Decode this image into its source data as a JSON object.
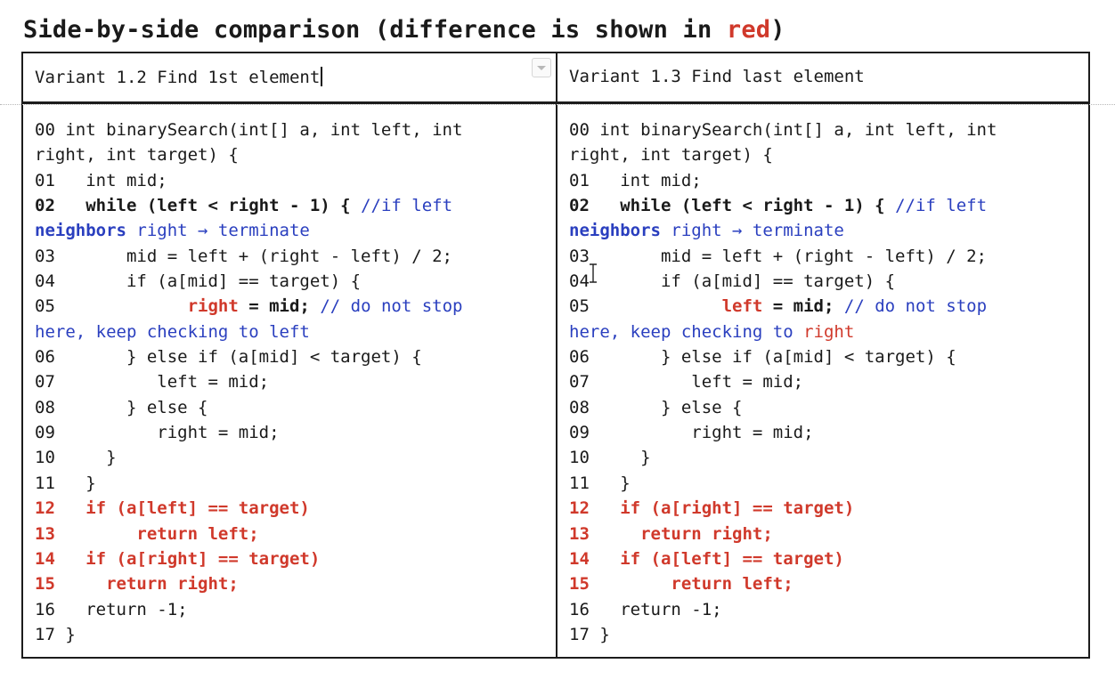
{
  "title": {
    "prefix": "Side-by-side comparison (difference is shown in ",
    "highlight": "red",
    "suffix": ")"
  },
  "left_header": "Variant 1.2 Find 1st element",
  "right_header": "Variant 1.3 Find last element",
  "left_code": {
    "l00a": "00 int binarySearch(int[] a, int left, int",
    "l00b": "right, int target) {",
    "l01": "01   int mid;",
    "l02_num": "02",
    "l02_code": "   while (left < right - 1) { ",
    "l02_comment": "//if left",
    "l02b_bold": "neighbors",
    "l02b_rest": " right → terminate",
    "l03": "03       mid = left + (right - left) / 2;",
    "l04": "04       if (a[mid] == target) {",
    "l05_pre": "05             ",
    "l05_red": "right",
    "l05_bold": " = mid;",
    "l05_comment": " // do not stop",
    "l05b": "here, keep checking to left",
    "l06": "06       } else if (a[mid] < target) {",
    "l07": "07          left = mid;",
    "l08": "08       } else {",
    "l09": "09          right = mid;",
    "l10": "10     }",
    "l11": "11   }",
    "l12": "12   if (a[left] == target)",
    "l13": "13        return left;",
    "l14": "14   if (a[right] == target)",
    "l15": "15     return right;",
    "l16": "16   return -1;",
    "l17": "17 }"
  },
  "right_code": {
    "l00a": "00 int binarySearch(int[] a, int left, int",
    "l00b": "right, int target) {",
    "l01": "01   int mid;",
    "l02_num": "02",
    "l02_code": "   while (left < right - 1) { ",
    "l02_comment": "//if left",
    "l02b_bold": "neighbors",
    "l02b_rest": " right → terminate",
    "l03": "03       mid = left + (right - left) / 2;",
    "l04": "04       if (a[mid] == target) {",
    "l05_pre": "05             ",
    "l05_red": "left",
    "l05_bold": " = mid;",
    "l05_comment": " // do not stop",
    "l05b_blue": "here, keep checking to ",
    "l05b_red": "right",
    "l06": "06       } else if (a[mid] < target) {",
    "l07": "07          left = mid;",
    "l08": "08       } else {",
    "l09": "09          right = mid;",
    "l10": "10     }",
    "l11": "11   }",
    "l12": "12   if (a[right] == target)",
    "l13": "13     return right;",
    "l14": "14   if (a[left] == target)",
    "l15": "15        return left;",
    "l16": "16   return -1;",
    "l17": "17 }"
  },
  "colors": {
    "diff_red": "#d0392b",
    "comment_blue": "#2a3fbf",
    "text": "#1a1a1a"
  }
}
